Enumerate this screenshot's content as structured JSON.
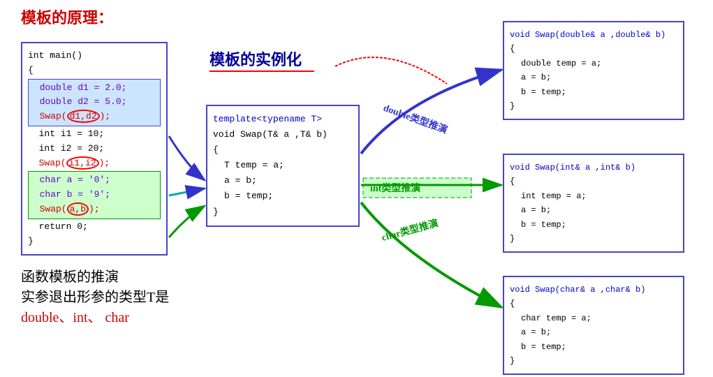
{
  "title": "模板的原理：",
  "label_instantiation": "模板的实例化",
  "main_code": {
    "lines": [
      {
        "text": "int main()",
        "color": "black"
      },
      {
        "text": "{",
        "color": "black"
      },
      {
        "text": "  double d1 = 2.0;",
        "color": "purple",
        "highlight": "blue"
      },
      {
        "text": "  double d2 = 5.0;",
        "color": "purple",
        "highlight": "blue"
      },
      {
        "text": "  Swap(d1,d2);",
        "color": "red",
        "highlight": "blue",
        "circle": true
      },
      {
        "text": "  int i1 = 10;",
        "color": "black"
      },
      {
        "text": "  int i2 = 20;",
        "color": "black"
      },
      {
        "text": "  Swap(i1,i2);",
        "color": "red",
        "circle": true
      },
      {
        "text": "  char a = '0';",
        "color": "purple",
        "highlight": "green"
      },
      {
        "text": "  char b = '9';",
        "color": "purple",
        "highlight": "green"
      },
      {
        "text": "  Swap(a,b);",
        "color": "red",
        "highlight": "green",
        "circle": true
      },
      {
        "text": "  return 0;",
        "color": "black"
      },
      {
        "text": "}",
        "color": "black"
      }
    ]
  },
  "template_code": {
    "lines": [
      {
        "text": "template<typename T>"
      },
      {
        "text": "void Swap(T& a ,T& b)"
      },
      {
        "text": "{"
      },
      {
        "text": "  T temp = a;"
      },
      {
        "text": "  a = b;"
      },
      {
        "text": "  b = temp;"
      },
      {
        "text": "}"
      }
    ]
  },
  "result_double": {
    "header": "void Swap(double& a ,double& b)",
    "lines": [
      "{",
      "  double temp = a;",
      "  a = b;",
      "  b = temp;",
      "}"
    ]
  },
  "result_int": {
    "header": "void Swap(int& a ,int& b)",
    "lines": [
      "{",
      "  int temp = a;",
      "  a = b;",
      "  b = temp;",
      "}"
    ]
  },
  "result_char": {
    "header": "void Swap(char& a ,char& b)",
    "lines": [
      "{",
      "  char temp = a;",
      "  a = b;",
      "  b = temp;",
      "}"
    ]
  },
  "arrow_double": "double类型推演",
  "arrow_int": "int类型推演",
  "arrow_char": "char类型推演",
  "bottom_line1": "函数模板的推演",
  "bottom_line2": "实参退出形参的类型T是",
  "bottom_line3": "double、int、 char"
}
